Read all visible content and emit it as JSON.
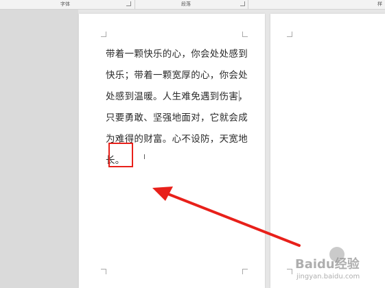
{
  "ribbon": {
    "font_group": "字体",
    "paragraph_group": "段落",
    "styles_group": "样"
  },
  "document": {
    "lines": [
      "带着一颗快乐的心，你会处处感到",
      "快乐；带着一颗宽厚的心，你会处",
      "处感到温暖。人生难免遇到伤害，",
      "只要勇敢、坚强地面对，它就会成",
      "为难得的财富。心不设防，天宽地",
      "长。"
    ]
  },
  "annotation": {
    "box_color": "#e8201a",
    "arrow_color": "#e8201a"
  },
  "watermark": {
    "brand": "Baidu经验",
    "sub": "jingyan.baidu.com"
  }
}
